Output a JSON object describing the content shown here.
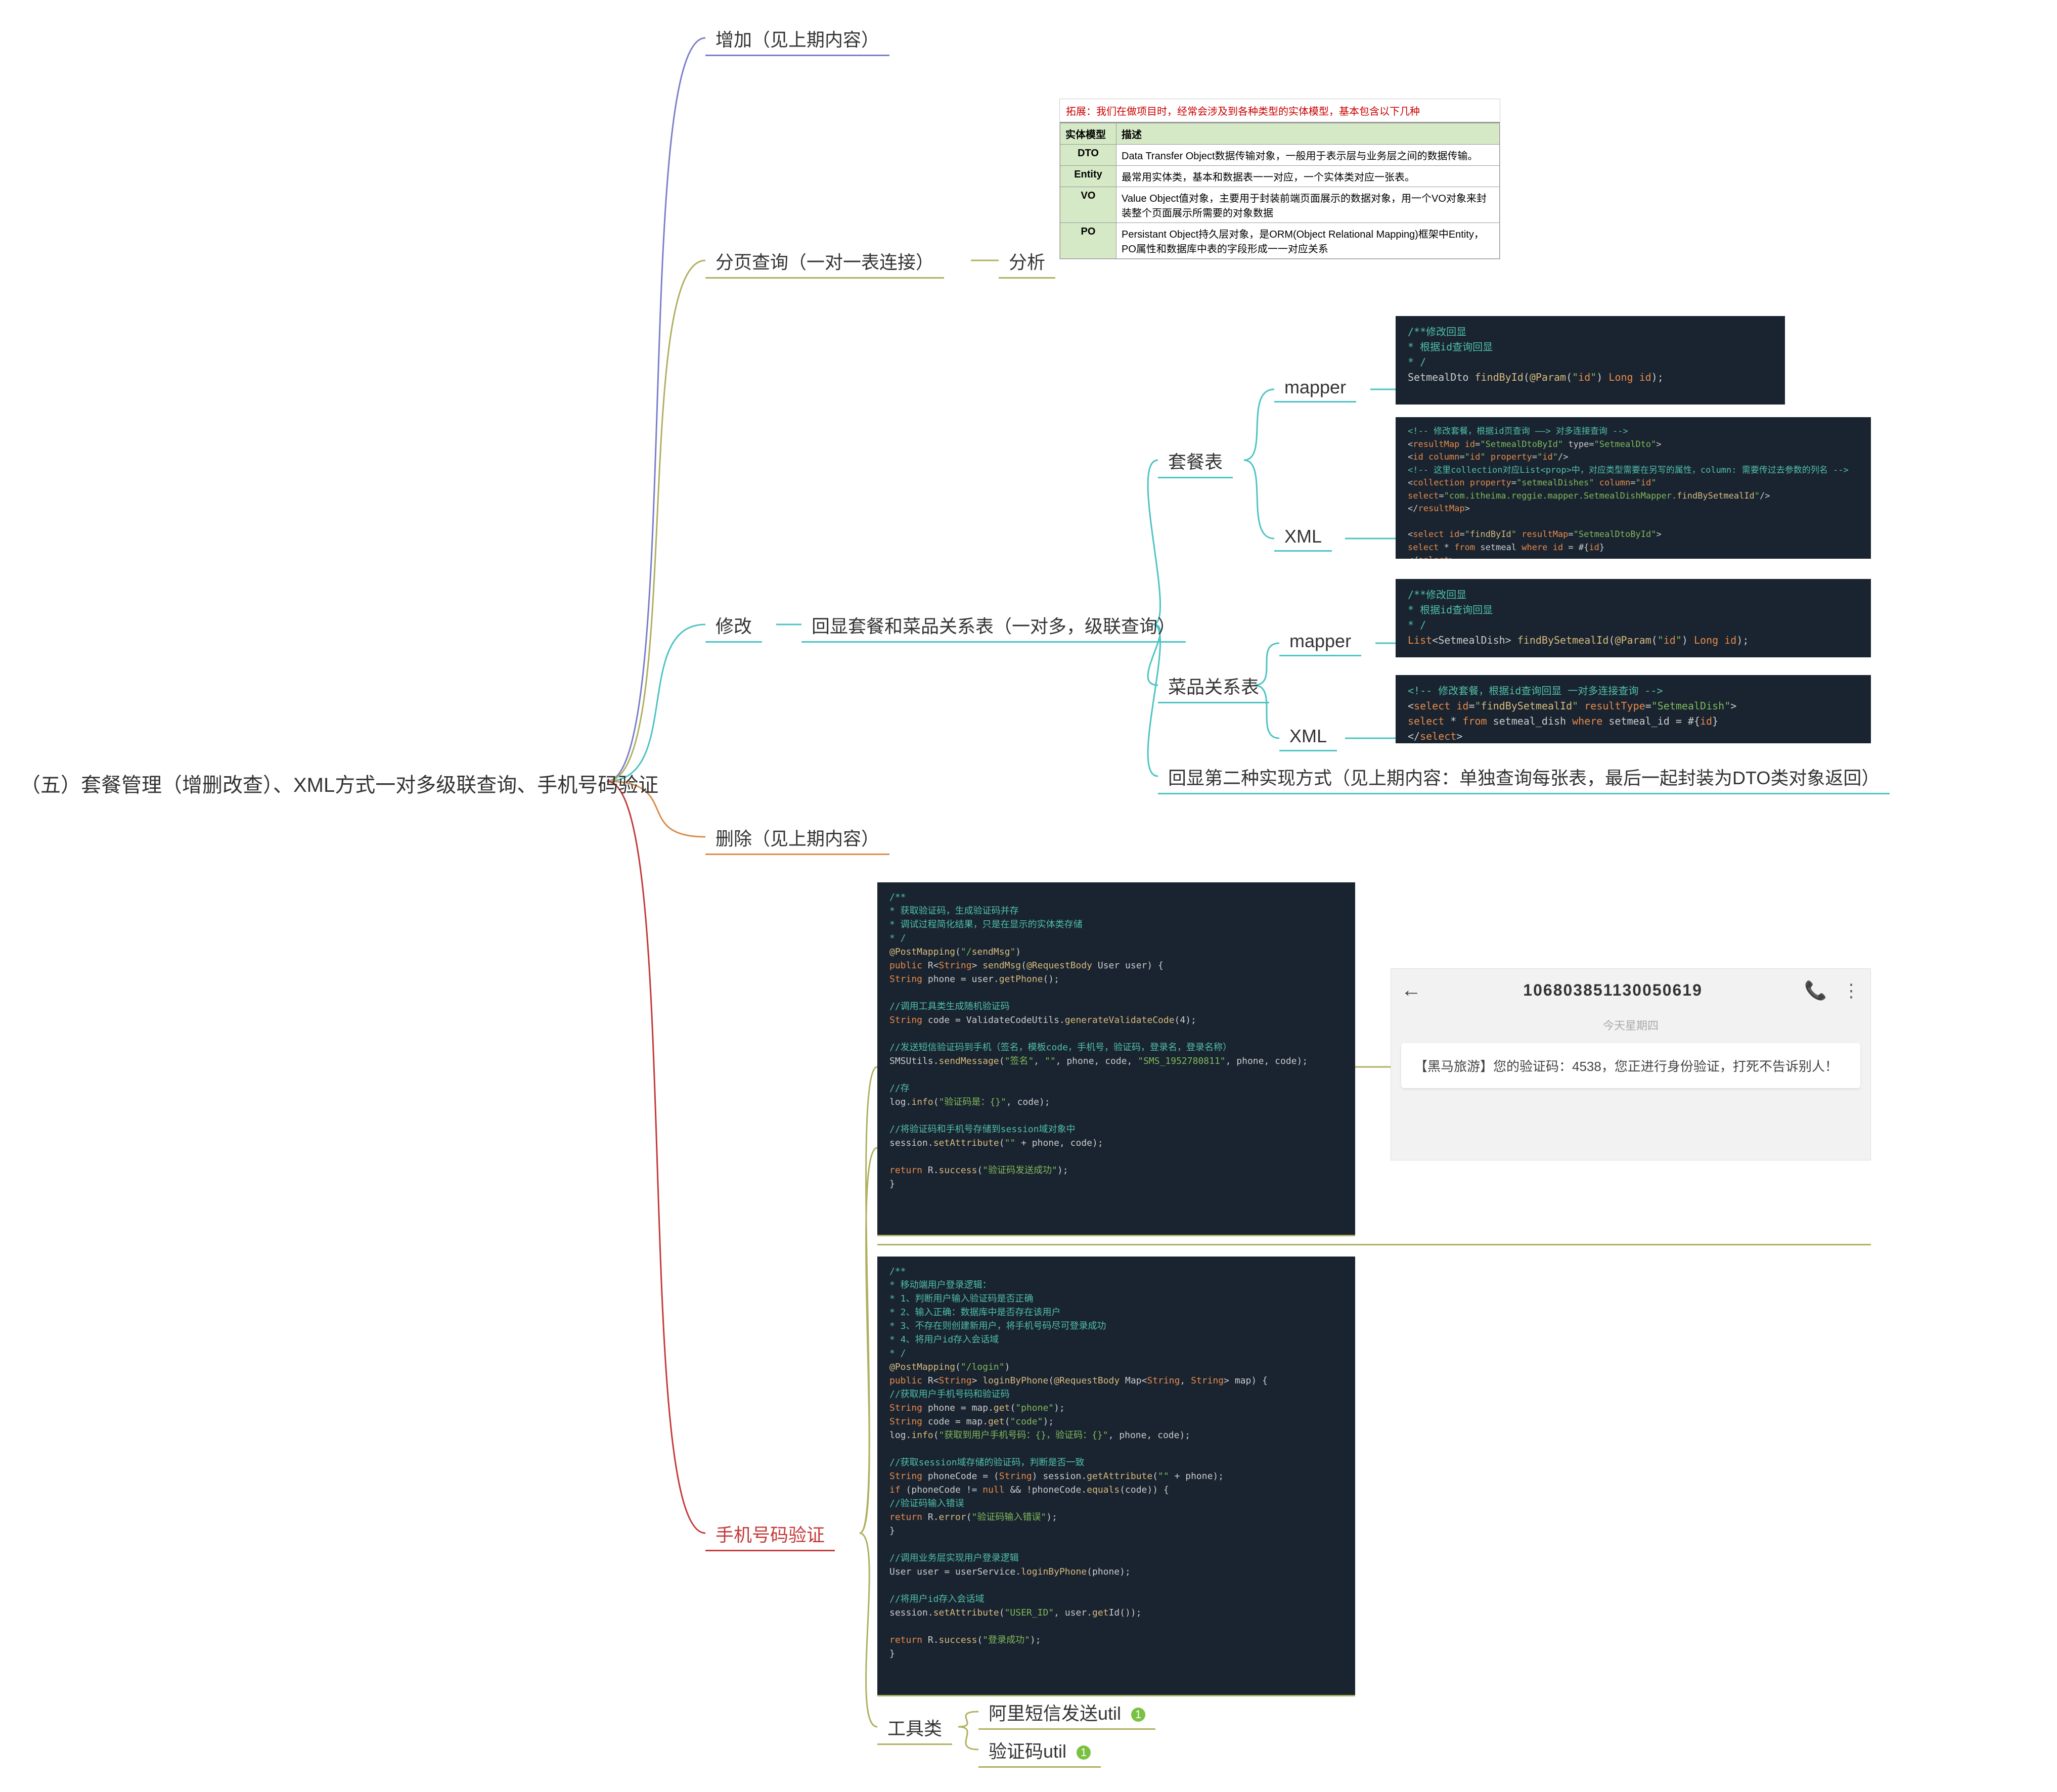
{
  "root": "（五）套餐管理（增删改查）、XML方式一对多级联查询、手机号码验证",
  "n_add": "增加（见上期内容）",
  "n_pagequery": "分页查询（一对一表连接）",
  "n_analyze": "分析",
  "n_modify": "修改",
  "n_echo_rel": "回显套餐和菜品关系表（一对多，级联查询）",
  "n_setmeal_table": "套餐表",
  "n_dish_rel_table": "菜品关系表",
  "n_mapper1": "mapper",
  "n_mapper2": "mapper",
  "n_xml1": "XML",
  "n_xml2": "XML",
  "n_echo_second": "回显第二种实现方式（见上期内容：单独查询每张表，最后一起封装为DTO类对象返回）",
  "n_delete": "删除（见上期内容）",
  "n_phone_verify": "手机号码验证",
  "n_utils": "工具类",
  "n_util_sms": "阿里短信发送util",
  "n_util_code": "验证码util",
  "badge": "1",
  "tbl": {
    "title": "拓展：我们在做项目时，经常会涉及到各种类型的实体模型，基本包含以下几种",
    "h1": "实体模型",
    "h2": "描述",
    "rows": [
      [
        "DTO",
        "Data Transfer Object数据传输对象，一般用于表示层与业务层之间的数据传输。"
      ],
      [
        "Entity",
        "最常用实体类，基本和数据表一一对应，一个实体类对应一张表。"
      ],
      [
        "VO",
        "Value Object值对象，主要用于封装前端页面展示的数据对象，用一个VO对象来封装整个页面展示所需要的对象数据"
      ],
      [
        "PO",
        "Persistant Object持久层对象，是ORM(Object Relational Mapping)框架中Entity，PO属性和数据库中表的字段形成一一对应关系"
      ]
    ]
  },
  "code_mapper1": [
    "/**修改回显",
    " * 根据id查询回显",
    " * /",
    "SetmealDto findById(@Param(\"id\") Long id);"
  ],
  "code_xml1": [
    "<!-- 修改套餐，根据id页查询 ——> 对多连接查询 -->",
    "<resultMap id=\"SetmealDtoById\" type=\"SetmealDto\">",
    "  <id column=\"id\" property=\"id\"/>",
    "  <!-- 这里collection对应List<prop>中，对应类型需要在另写的属性，column: 需要传过去参数的列名 -->",
    "  <collection property=\"setmealDishes\" column=\"id\" select=\"com.itheima.reggie.mapper.SetmealDishMapper.findBySetmealId\"/>",
    "</resultMap>",
    "",
    "<select id=\"findById\" resultMap=\"SetmealDtoById\">",
    "    select * from setmeal where id = #{id}",
    "</select>"
  ],
  "code_mapper2": [
    "/**修改回显",
    " * 根据id查询回显",
    " * /",
    "List<SetmealDish> findBySetmealId(@Param(\"id\") Long id);"
  ],
  "code_xml2": [
    "<!-- 修改套餐，根据id查询回显 一对多连接查询 -->",
    "<select id=\"findBySetmealId\" resultType=\"SetmealDish\">",
    "    select * from setmeal_dish where setmeal_id = #{id}",
    "</select>"
  ],
  "code_send": [
    "/**",
    " * 获取验证码，生成验证码并存",
    " * 调试过程简化结果，只是在显示的实体类存储",
    " * /",
    "@PostMapping(\"/sendMsg\")",
    "public R<String> sendMsg(@RequestBody User user) {",
    "  String phone = user.getPhone();",
    "",
    "  //调用工具类生成随机验证码",
    "  String code = ValidateCodeUtils.generateValidateCode(4);",
    "",
    "  //发送短信验证码到手机（签名，模板code，手机号，验证码，登录名，登录名称）",
    "  SMSUtils.sendMessage(\"签名\", \"\", phone, code, \"SMS_1952780811\", phone, code);",
    "",
    "  //存",
    "  log.info(\"验证码是：{}\", code);",
    "",
    "  //将验证码和手机号存储到session域对象中",
    "  session.setAttribute(\"\" + phone, code);",
    "",
    "  return R.success(\"验证码发送成功\");",
    "}"
  ],
  "code_login": [
    "/**",
    " * 移动端用户登录逻辑：",
    " * 1、判断用户输入验证码是否正确",
    " * 2、输入正确：数据库中是否存在该用户",
    " * 3、不存在则创建新用户，将手机号码尽可登录成功",
    " * 4、将用户id存入会话域",
    " * /",
    "@PostMapping(\"/login\")",
    "public R<String> loginByPhone(@RequestBody Map<String, String> map) {",
    "  //获取用户手机号码和验证码",
    "  String phone = map.get(\"phone\");",
    "  String code = map.get(\"code\");",
    "  log.info(\"获取到用户手机号码：{}，验证码：{}\", phone, code);",
    "",
    "  //获取session域存储的验证码，判断是否一致",
    "  String phoneCode = (String) session.getAttribute(\"\" + phone);",
    "  if (phoneCode != null && !phoneCode.equals(code)) {",
    "    //验证码输入错误",
    "    return R.error(\"验证码输入错误\");",
    "  }",
    "",
    "  //调用业务层实现用户登录逻辑",
    "  User user = userService.loginByPhone(phone);",
    "",
    "  //将用户id存入会话域",
    "  session.setAttribute(\"USER_ID\", user.getId());",
    "",
    "  return R.success(\"登录成功\");",
    "}"
  ],
  "sms": {
    "number": "106803851130050619",
    "date": "今天星期四",
    "body": "【黑马旅游】您的验证码：4538，您正进行身份验证，打死不告诉别人！"
  }
}
